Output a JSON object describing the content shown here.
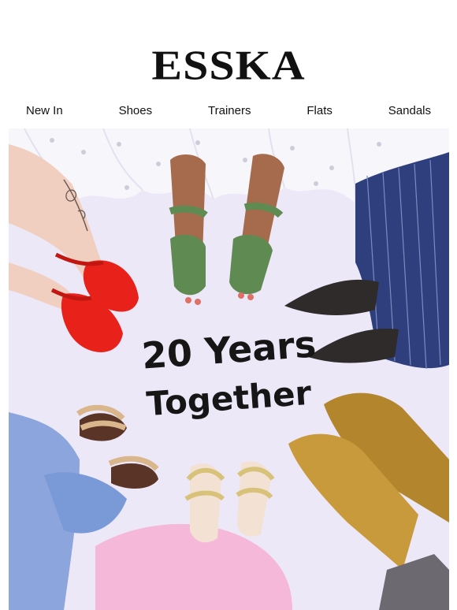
{
  "brand": {
    "logo_text": "ESSKA"
  },
  "nav": {
    "items": [
      "New In",
      "Shoes",
      "Trainers",
      "Flats",
      "Sandals"
    ]
  },
  "hero": {
    "headline_line1": "20 Years",
    "headline_line2": "Together",
    "background_color": "#ede9f8"
  },
  "icons": [
    "essentials"
  ]
}
